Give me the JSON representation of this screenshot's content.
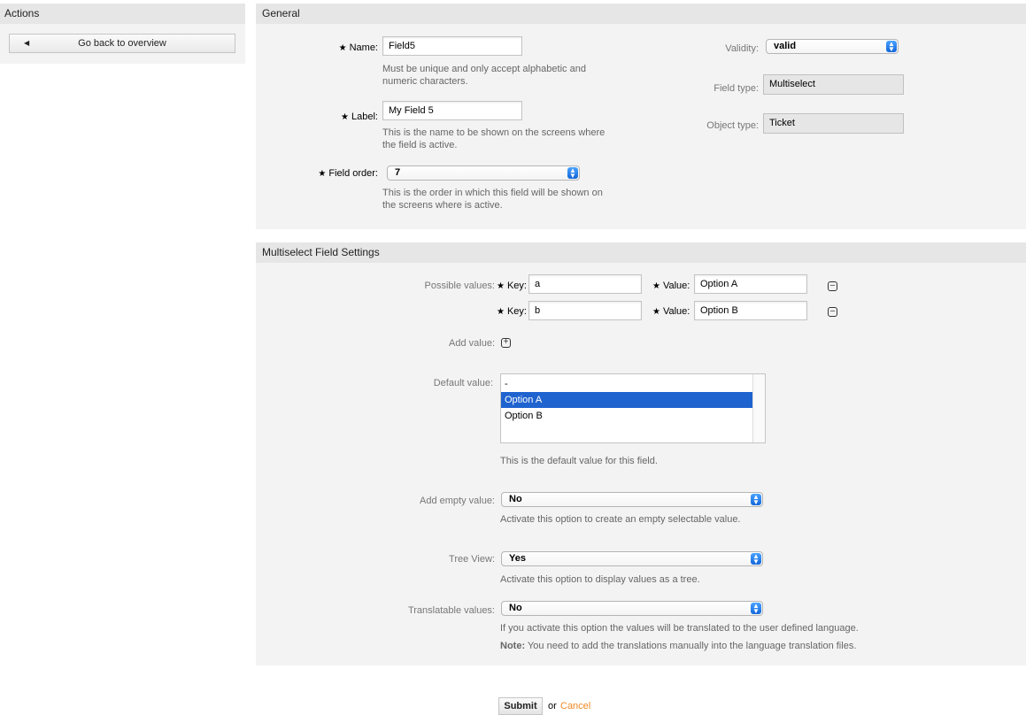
{
  "sidebar": {
    "title": "Actions",
    "back_label": "Go back to overview"
  },
  "general": {
    "title": "General",
    "name": {
      "label": "Name:",
      "value": "Field5",
      "hint": [
        "Must be unique and only accept alphabetic and",
        "numeric characters."
      ]
    },
    "label": {
      "label": "Label:",
      "value": "My Field 5",
      "hint": [
        "This is the name to be shown on the screens where",
        "the field is active."
      ]
    },
    "order": {
      "label": "Field order:",
      "value": "7",
      "hint": [
        "This is the order in which this field will be shown on",
        "the screens where is active."
      ]
    },
    "validity": {
      "label": "Validity:",
      "value": "valid"
    },
    "field_type": {
      "label": "Field type:",
      "value": "Multiselect"
    },
    "object_type": {
      "label": "Object type:",
      "value": "Ticket"
    }
  },
  "settings": {
    "title": "Multiselect Field Settings",
    "possible_values_label": "Possible values:",
    "key_label": "Key:",
    "value_label": "Value:",
    "rows": [
      {
        "key": "a",
        "value": "Option A"
      },
      {
        "key": "b",
        "value": "Option B"
      }
    ],
    "add_value_label": "Add value:",
    "default_value": {
      "label": "Default value:",
      "options": [
        "-",
        "Option A",
        "Option B"
      ],
      "selected": "Option A",
      "hint": "This is the default value for this field."
    },
    "add_empty": {
      "label": "Add empty value:",
      "value": "No",
      "hint": "Activate this option to create an empty selectable value."
    },
    "tree_view": {
      "label": "Tree View:",
      "value": "Yes",
      "hint": "Activate this option to display values as a tree."
    },
    "translatable": {
      "label": "Translatable values:",
      "value": "No",
      "hint": "If you activate this option the values will be translated to the user defined language.",
      "note_bold": "Note:",
      "note": " You need to add the translations manually into the language translation files."
    }
  },
  "footer": {
    "submit_label": "Submit",
    "or_label": "or",
    "cancel_label": "Cancel"
  },
  "colors": {
    "accent_link": "#f08a24",
    "selection": "#1f63cf"
  }
}
